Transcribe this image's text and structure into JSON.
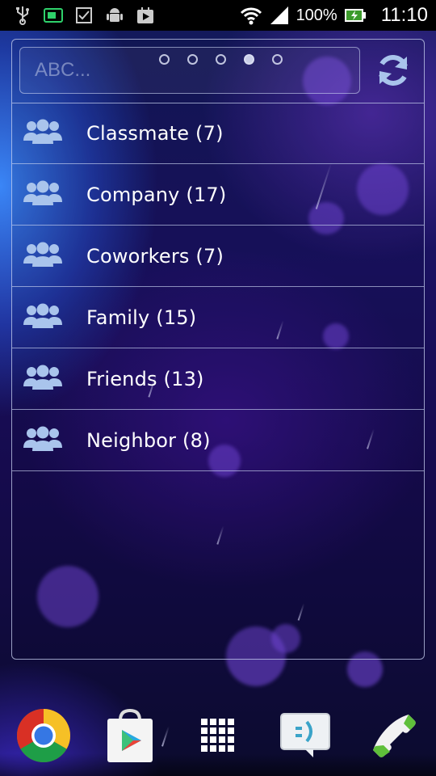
{
  "status_bar": {
    "battery": "100%",
    "time": "11:10",
    "icons": [
      "usb-icon",
      "storage-icon",
      "checkbox-icon",
      "android-icon",
      "play-store-notification-icon",
      "wifi-icon",
      "signal-icon",
      "battery-charging-icon"
    ]
  },
  "widget": {
    "search_placeholder": "ABC...",
    "page_indicator": {
      "count": 5,
      "active_index": 3
    },
    "refresh_icon": "refresh-icon",
    "groups": [
      {
        "label": "Classmate (7)",
        "icon": "group-icon"
      },
      {
        "label": "Company (17)",
        "icon": "group-icon"
      },
      {
        "label": "Coworkers (7)",
        "icon": "group-icon"
      },
      {
        "label": "Family (15)",
        "icon": "group-icon"
      },
      {
        "label": "Friends (13)",
        "icon": "group-icon"
      },
      {
        "label": "Neighbor (8)",
        "icon": "group-icon"
      }
    ]
  },
  "dock": {
    "items": [
      "chrome-icon",
      "play-store-icon",
      "app-drawer-icon",
      "messaging-icon",
      "phone-icon"
    ]
  },
  "colors": {
    "icon_blue": "#a9c4ec",
    "divider": "#c8d2f0",
    "text": "#ffffff"
  }
}
